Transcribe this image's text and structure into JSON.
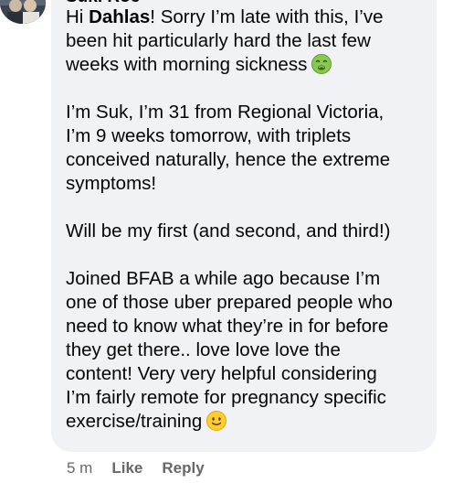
{
  "comment": {
    "author": "Suki Roe",
    "mention": "Dahlas",
    "line1_before": "Hi ",
    "line1_after": "! Sorry I’m late with this, I’ve",
    "line2": "been hit particularly hard the last few",
    "line3": "weeks with morning sickness",
    "line3_emoji": "nauseated-face-icon",
    "line4": "I’m Suk, I’m 31 from Regional Victoria,",
    "line5": "I’m 9 weeks tomorrow, with triplets",
    "line6": "conceived naturally, hence the extreme",
    "line7": "symptoms!",
    "line8": "Will be my first (and second, and third!)",
    "line9": "Joined BFAB a while ago because I’m",
    "line10": "one of those uber prepared people who",
    "line11": "need to know what they’re in for before",
    "line12": "they get there.. love love love the",
    "line13": "content! Very very helpful considering",
    "line14": "I’m fairly remote for pregnancy specific",
    "line15": "exercise/training",
    "line15_emoji": "slightly-smiling-face-icon"
  },
  "actions": {
    "time": "5 m",
    "like_label": "Like",
    "reply_label": "Reply"
  },
  "colors": {
    "bubble": "#f0f2f5",
    "text": "#050505",
    "meta": "#65676b"
  }
}
